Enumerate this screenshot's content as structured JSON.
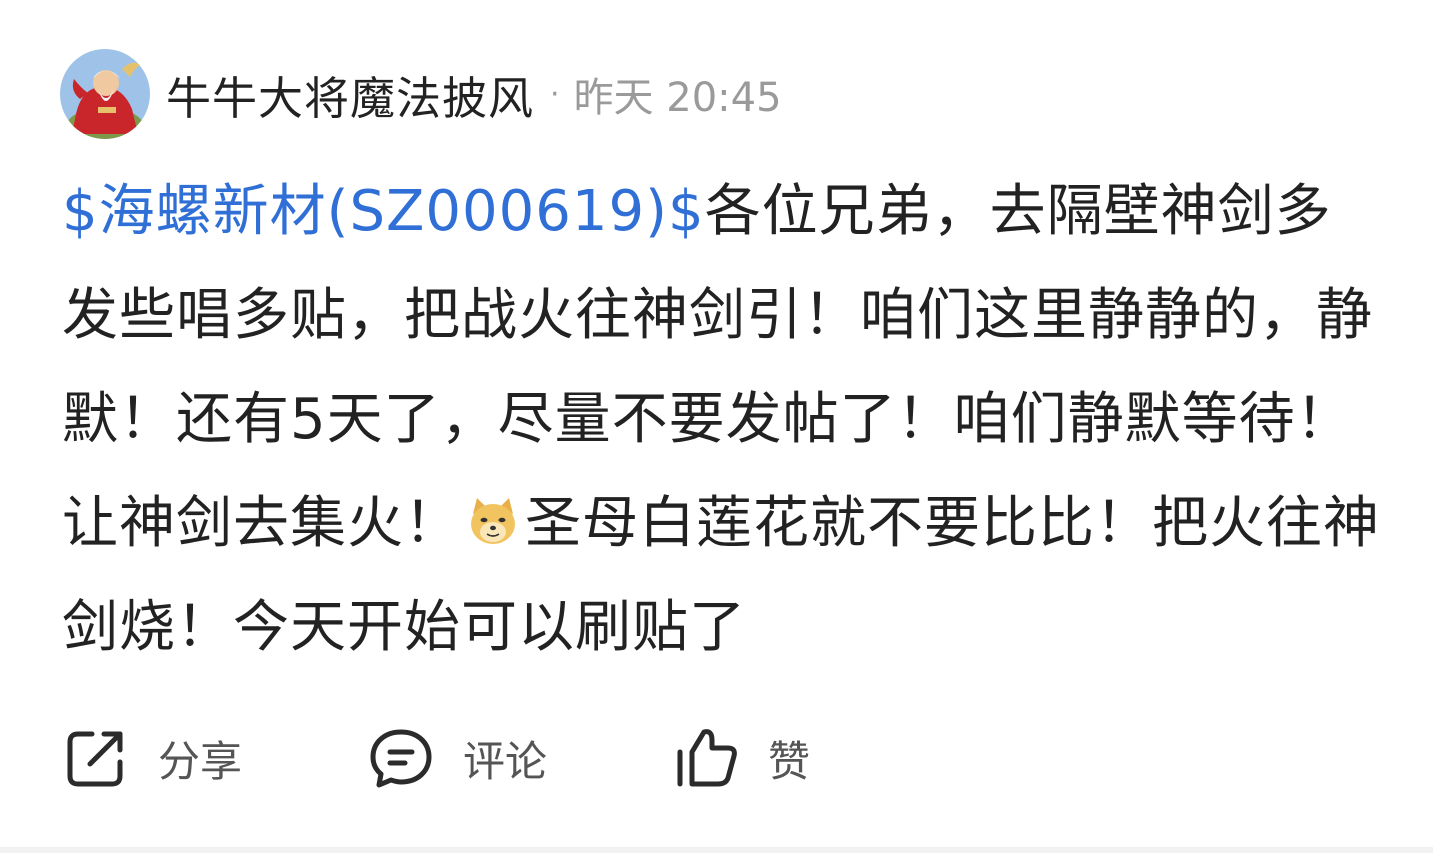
{
  "post": {
    "author_name": "牛牛大将魔法披风",
    "separator": "·",
    "timestamp": "昨天 20:45",
    "stock_tag": "$海螺新材(SZ000619)$",
    "body_part1": "各位兄弟，去隔壁神剑多发些唱多贴，把战火往神剑引！咱们这里静静的，静默！还有5天了，尽量不要发帖了！咱们静默等待！让神剑去集火！",
    "body_part2": "圣母白莲花就不要比比！把火往神剑烧！今天开始可以刷贴了"
  },
  "actions": {
    "share_label": "分享",
    "comment_label": "评论",
    "like_label": "赞"
  },
  "colors": {
    "link": "#2f6fd6",
    "text": "#222222",
    "meta": "#9a9a9a",
    "action_text": "#555555"
  },
  "icons": {
    "avatar": "avatar-image",
    "emoji": "doge-emoji-icon",
    "share": "share-icon",
    "comment": "comment-icon",
    "like": "thumbs-up-icon"
  }
}
